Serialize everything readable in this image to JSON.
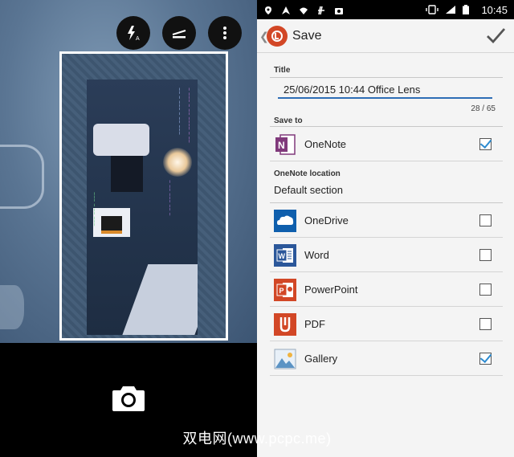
{
  "status_bar": {
    "time": "10:45"
  },
  "app_bar": {
    "title": "Save"
  },
  "form": {
    "title_label": "Title",
    "title_value": "25/06/2015 10:44 Office Lens",
    "char_count": "28 / 65",
    "save_to_label": "Save to",
    "location_label": "OneNote location",
    "location_value": "Default section"
  },
  "targets": [
    {
      "label": "OneNote",
      "checked": true,
      "icon": "onenote-icon",
      "color": "#80397b"
    },
    {
      "label": "OneDrive",
      "checked": false,
      "icon": "onedrive-icon",
      "color": "#0f5fad"
    },
    {
      "label": "Word",
      "checked": false,
      "icon": "word-icon",
      "color": "#2b579a"
    },
    {
      "label": "PowerPoint",
      "checked": false,
      "icon": "powerpoint-icon",
      "color": "#d24726"
    },
    {
      "label": "PDF",
      "checked": false,
      "icon": "pdf-icon",
      "color": "#d24726"
    },
    {
      "label": "Gallery",
      "checked": true,
      "icon": "gallery-icon",
      "color": "#5b93c4"
    }
  ],
  "camera": {
    "icons": [
      "flash-auto-icon",
      "scan-mode-icon",
      "more-vert-icon",
      "camera-icon"
    ]
  },
  "watermark": "双电网(www.pcpc.me)"
}
